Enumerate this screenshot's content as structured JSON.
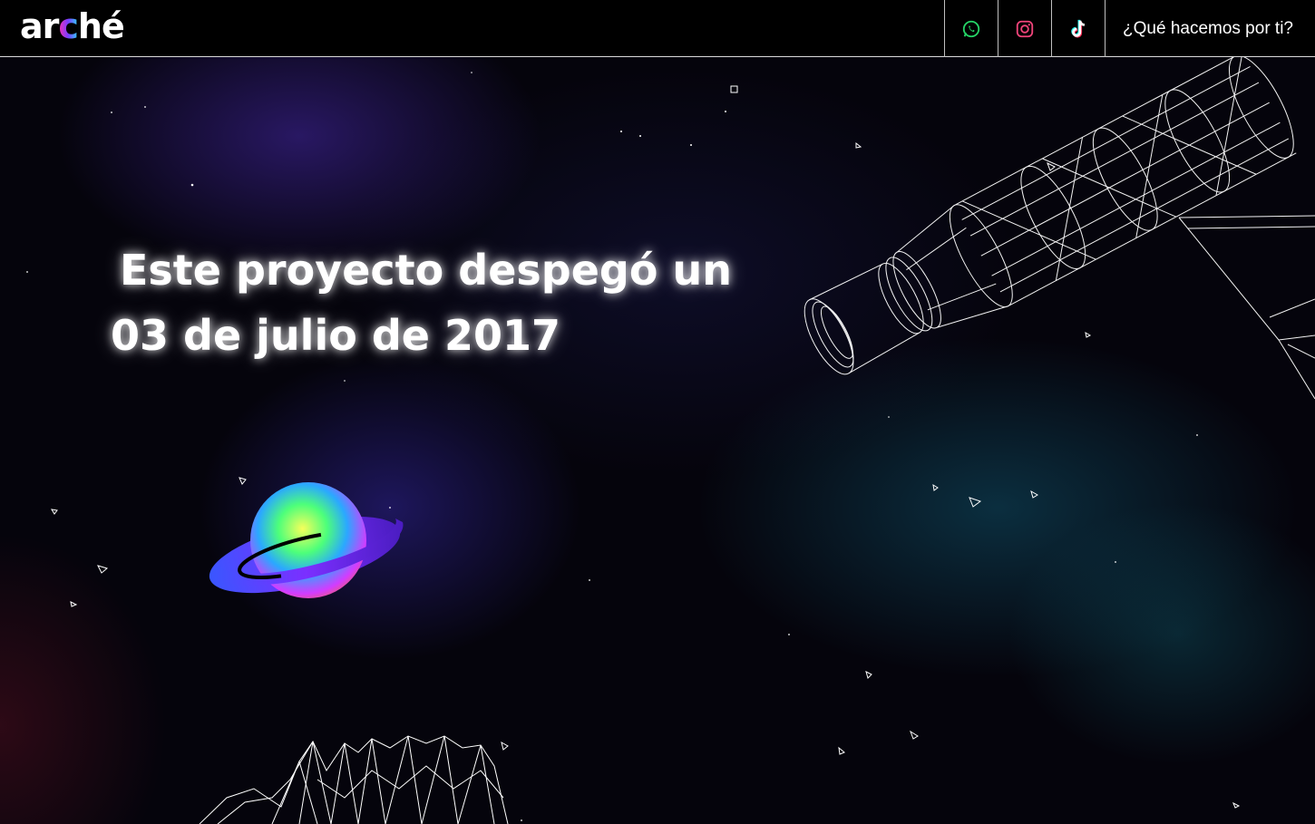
{
  "header": {
    "logo": {
      "pre": "ar",
      "accent": "c",
      "post": "hé"
    },
    "social": [
      {
        "name": "whatsapp",
        "icon": "whatsapp-icon",
        "color": "#25d366"
      },
      {
        "name": "instagram",
        "icon": "instagram-icon",
        "color": "#e4405f"
      },
      {
        "name": "tiktok",
        "icon": "tiktok-icon",
        "color": "#ff0050"
      }
    ],
    "cta_label": "¿Qué hacemos por ti?"
  },
  "hero": {
    "line1": "Este proyecto despegó un",
    "line2": "03 de julio de 2017"
  },
  "decor": {
    "planet": "ringed-planet-illustration",
    "rocket": "wireframe-rocket-illustration",
    "mountain": "wireframe-mountain-illustration"
  }
}
